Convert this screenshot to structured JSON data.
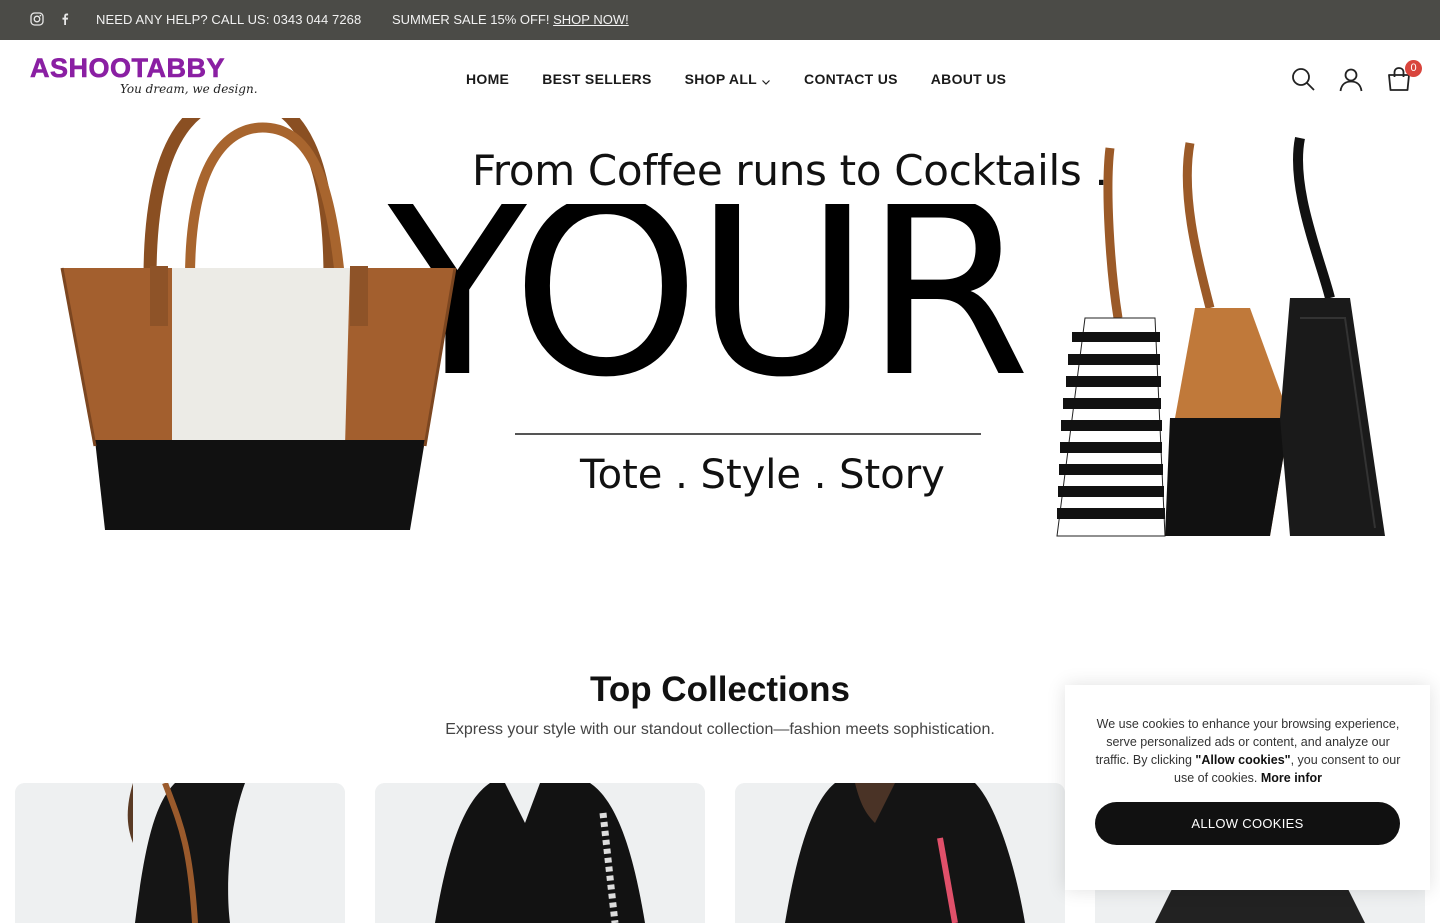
{
  "topbar": {
    "help_text": "NEED ANY HELP? CALL US: 0343 044 7268",
    "sale_text": "SUMMER SALE 15% OFF!",
    "sale_link": "SHOP NOW!",
    "social": [
      "instagram-icon",
      "facebook-icon"
    ]
  },
  "header": {
    "brand": "ASHOOTABBY",
    "tagline": "You dream, we design.",
    "nav": [
      {
        "label": "HOME"
      },
      {
        "label": "BEST SELLERS"
      },
      {
        "label": "SHOP ALL"
      },
      {
        "label": "CONTACT US"
      },
      {
        "label": "ABOUT US"
      }
    ],
    "icons": [
      "search-icon",
      "account-icon",
      "cart-icon"
    ],
    "cart_count": "0",
    "brand_color": "#8a1fa3"
  },
  "hero": {
    "headline": "From Coffee runs to Cocktails .",
    "big_word": "YOUR",
    "subline": "Tote . Style . Story"
  },
  "collections": {
    "title": "Top Collections",
    "subtitle": "Express your style with our standout collection—fashion meets sophistication."
  },
  "cookie": {
    "text_before": "We use cookies to enhance your browsing experience, serve personalized ads or content, and analyze our traffic. By clicking ",
    "text_bold": "\"Allow cookies\"",
    "text_after": ", you consent to our use of cookies. ",
    "more_link": "More infor",
    "button": "ALLOW COOKIES"
  },
  "colors": {
    "topbar_bg": "#4b4b47",
    "badge": "#d9453d",
    "button_bg": "#111111"
  }
}
